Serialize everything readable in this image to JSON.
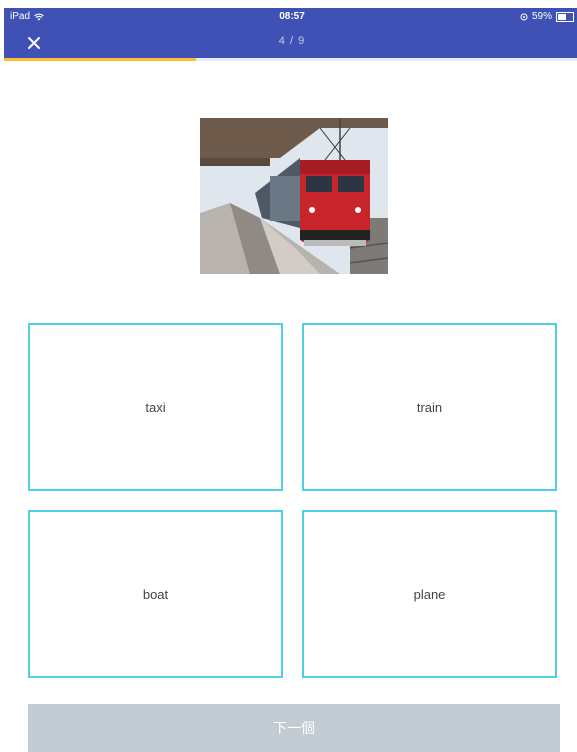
{
  "status_bar": {
    "device": "iPad",
    "time": "08:57",
    "battery": "59%",
    "battery_level": 0.59
  },
  "header": {
    "progress_label": "4 / 9",
    "progress_fraction": 0.333
  },
  "question": {
    "image_icon": "train-photo"
  },
  "options": [
    {
      "label": "taxi"
    },
    {
      "label": "train"
    },
    {
      "label": "boat"
    },
    {
      "label": "plane"
    }
  ],
  "footer": {
    "next_label": "下一個"
  },
  "colors": {
    "header_bg": "#3f51b5",
    "progress": "#fbc02d",
    "option_border": "#4dd0e1",
    "next_bg": "#c4ccd3"
  }
}
